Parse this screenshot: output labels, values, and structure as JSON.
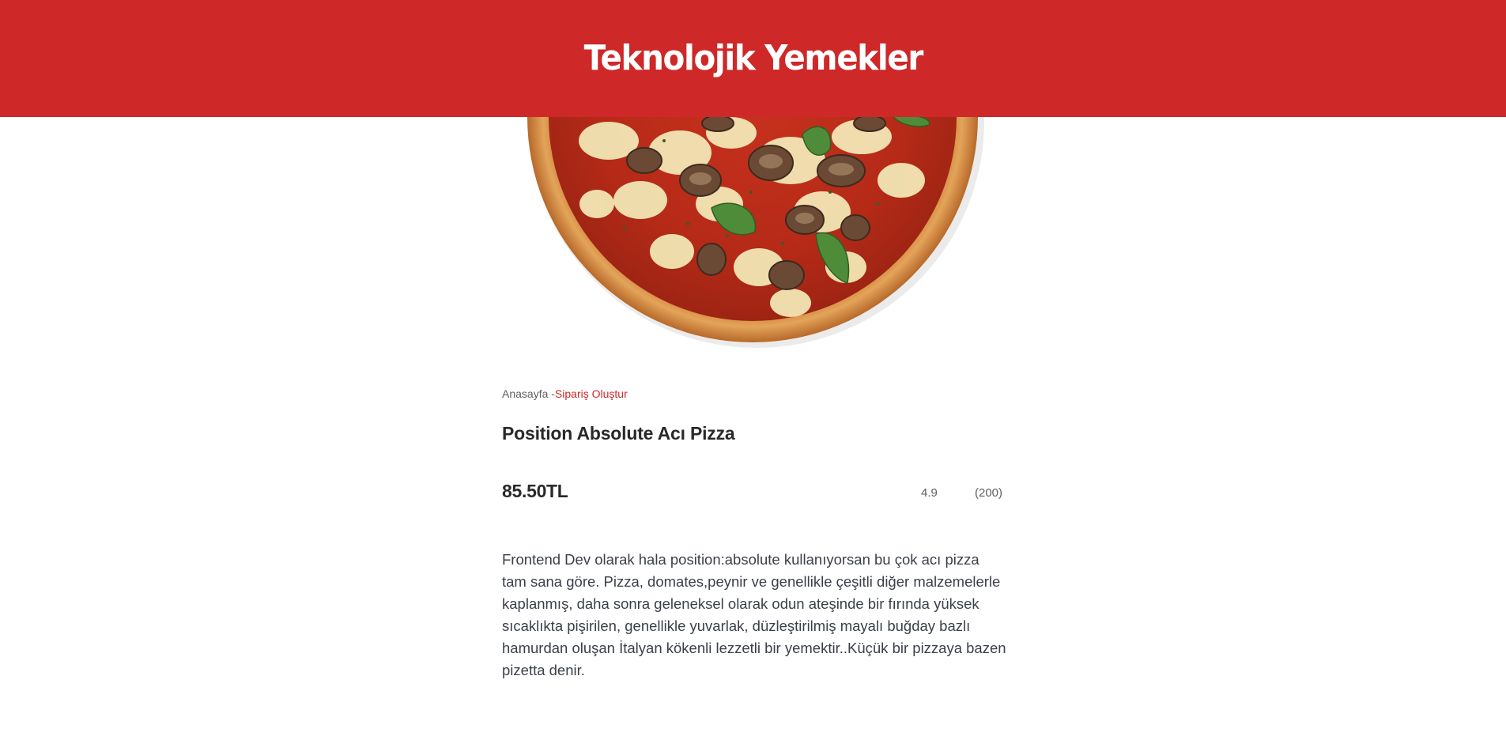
{
  "header": {
    "brand": "Teknolojik Yemekler",
    "background_color": "#ce2829"
  },
  "hero": {
    "image": "pizza-image"
  },
  "breadcrumb": {
    "home": "Anasayfa -",
    "current": "Sipariş Oluştur",
    "accent_color": "#ce2829"
  },
  "product": {
    "title": "Position Absolute Acı Pizza",
    "price": "85.50TL",
    "rating": "4.9",
    "reviews": "(200)",
    "description": "Frontend Dev olarak hala position:absolute kullanıyorsan bu çok acı pizza tam sana göre. Pizza, domates,peynir ve genellikle çeşitli diğer malzemelerle kaplanmış, daha sonra geleneksel olarak odun ateşinde bir fırında yüksek sıcaklıkta pişirilen, genellikle yuvarlak, düzleştirilmiş mayalı buğday bazlı hamurdan oluşan İtalyan kökenli lezzetli bir yemektir..Küçük bir pizzaya bazen pizetta denir."
  }
}
